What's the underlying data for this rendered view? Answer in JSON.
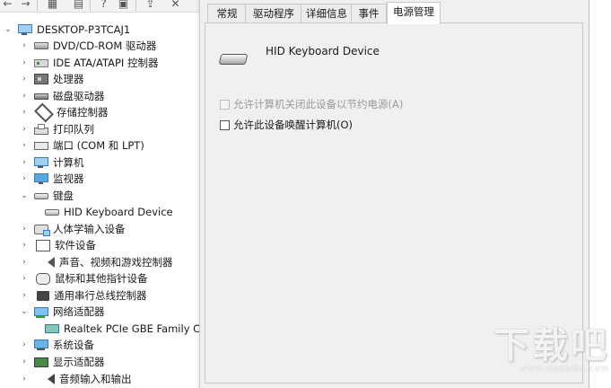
{
  "toolbar": {
    "buttons": [
      {
        "icon": "back-arrow-icon",
        "glyph": "←"
      },
      {
        "icon": "forward-arrow-icon",
        "glyph": "→"
      },
      {
        "icon": "show-hide-tree-icon",
        "glyph": "▦"
      },
      {
        "icon": "properties-icon",
        "glyph": "▤"
      },
      {
        "icon": "help-icon",
        "glyph": "?"
      },
      {
        "icon": "scan-hardware-icon",
        "glyph": "▣"
      },
      {
        "icon": "update-driver-icon",
        "glyph": "⇪"
      },
      {
        "icon": "uninstall-icon",
        "glyph": "✕"
      }
    ]
  },
  "tree": {
    "root": "DESKTOP-P3TCAJ1",
    "items": [
      {
        "label": "DVD/CD-ROM 驱动器",
        "icon": "disc-drive-icon",
        "expanded": false
      },
      {
        "label": "IDE ATA/ATAPI 控制器",
        "icon": "ide-controller-icon",
        "expanded": false
      },
      {
        "label": "处理器",
        "icon": "processor-icon",
        "expanded": false
      },
      {
        "label": "磁盘驱动器",
        "icon": "disk-drive-icon",
        "expanded": false
      },
      {
        "label": "存储控制器",
        "icon": "storage-controller-icon",
        "expanded": false
      },
      {
        "label": "打印队列",
        "icon": "printer-icon",
        "expanded": false
      },
      {
        "label": "端口 (COM 和 LPT)",
        "icon": "port-icon",
        "expanded": false
      },
      {
        "label": "计算机",
        "icon": "computer-icon",
        "expanded": false
      },
      {
        "label": "监视器",
        "icon": "monitor-icon",
        "expanded": false
      },
      {
        "label": "键盘",
        "icon": "keyboard-icon",
        "expanded": true
      },
      {
        "label": "HID Keyboard Device",
        "icon": "keyboard-device-icon",
        "child": true
      },
      {
        "label": "人体学输入设备",
        "icon": "hid-icon",
        "expanded": false
      },
      {
        "label": "软件设备",
        "icon": "software-device-icon",
        "expanded": false
      },
      {
        "label": "声音、视频和游戏控制器",
        "icon": "sound-icon",
        "expanded": false
      },
      {
        "label": "鼠标和其他指针设备",
        "icon": "mouse-icon",
        "expanded": false
      },
      {
        "label": "通用串行总线控制器",
        "icon": "usb-icon",
        "expanded": false
      },
      {
        "label": "网络适配器",
        "icon": "network-adapter-icon",
        "expanded": true
      },
      {
        "label": "Realtek PCIe GBE Family Co",
        "icon": "network-card-icon",
        "child": true
      },
      {
        "label": "系统设备",
        "icon": "system-device-icon",
        "expanded": false
      },
      {
        "label": "显示适配器",
        "icon": "display-adapter-icon",
        "expanded": false
      },
      {
        "label": "音频输入和输出",
        "icon": "audio-io-icon",
        "expanded": false
      }
    ]
  },
  "dialog": {
    "tabs": [
      "常规",
      "驱动程序",
      "详细信息",
      "事件",
      "电源管理"
    ],
    "active_tab": "电源管理",
    "device_name": "HID Keyboard Device",
    "options": [
      {
        "label": "允许计算机关闭此设备以节约电源(A)",
        "checked": false,
        "disabled": true
      },
      {
        "label": "允许此设备唤醒计算机(O)",
        "checked": false,
        "disabled": false
      }
    ]
  },
  "watermark": {
    "text": "下载吧",
    "url": "www.xiazaiba.com"
  }
}
